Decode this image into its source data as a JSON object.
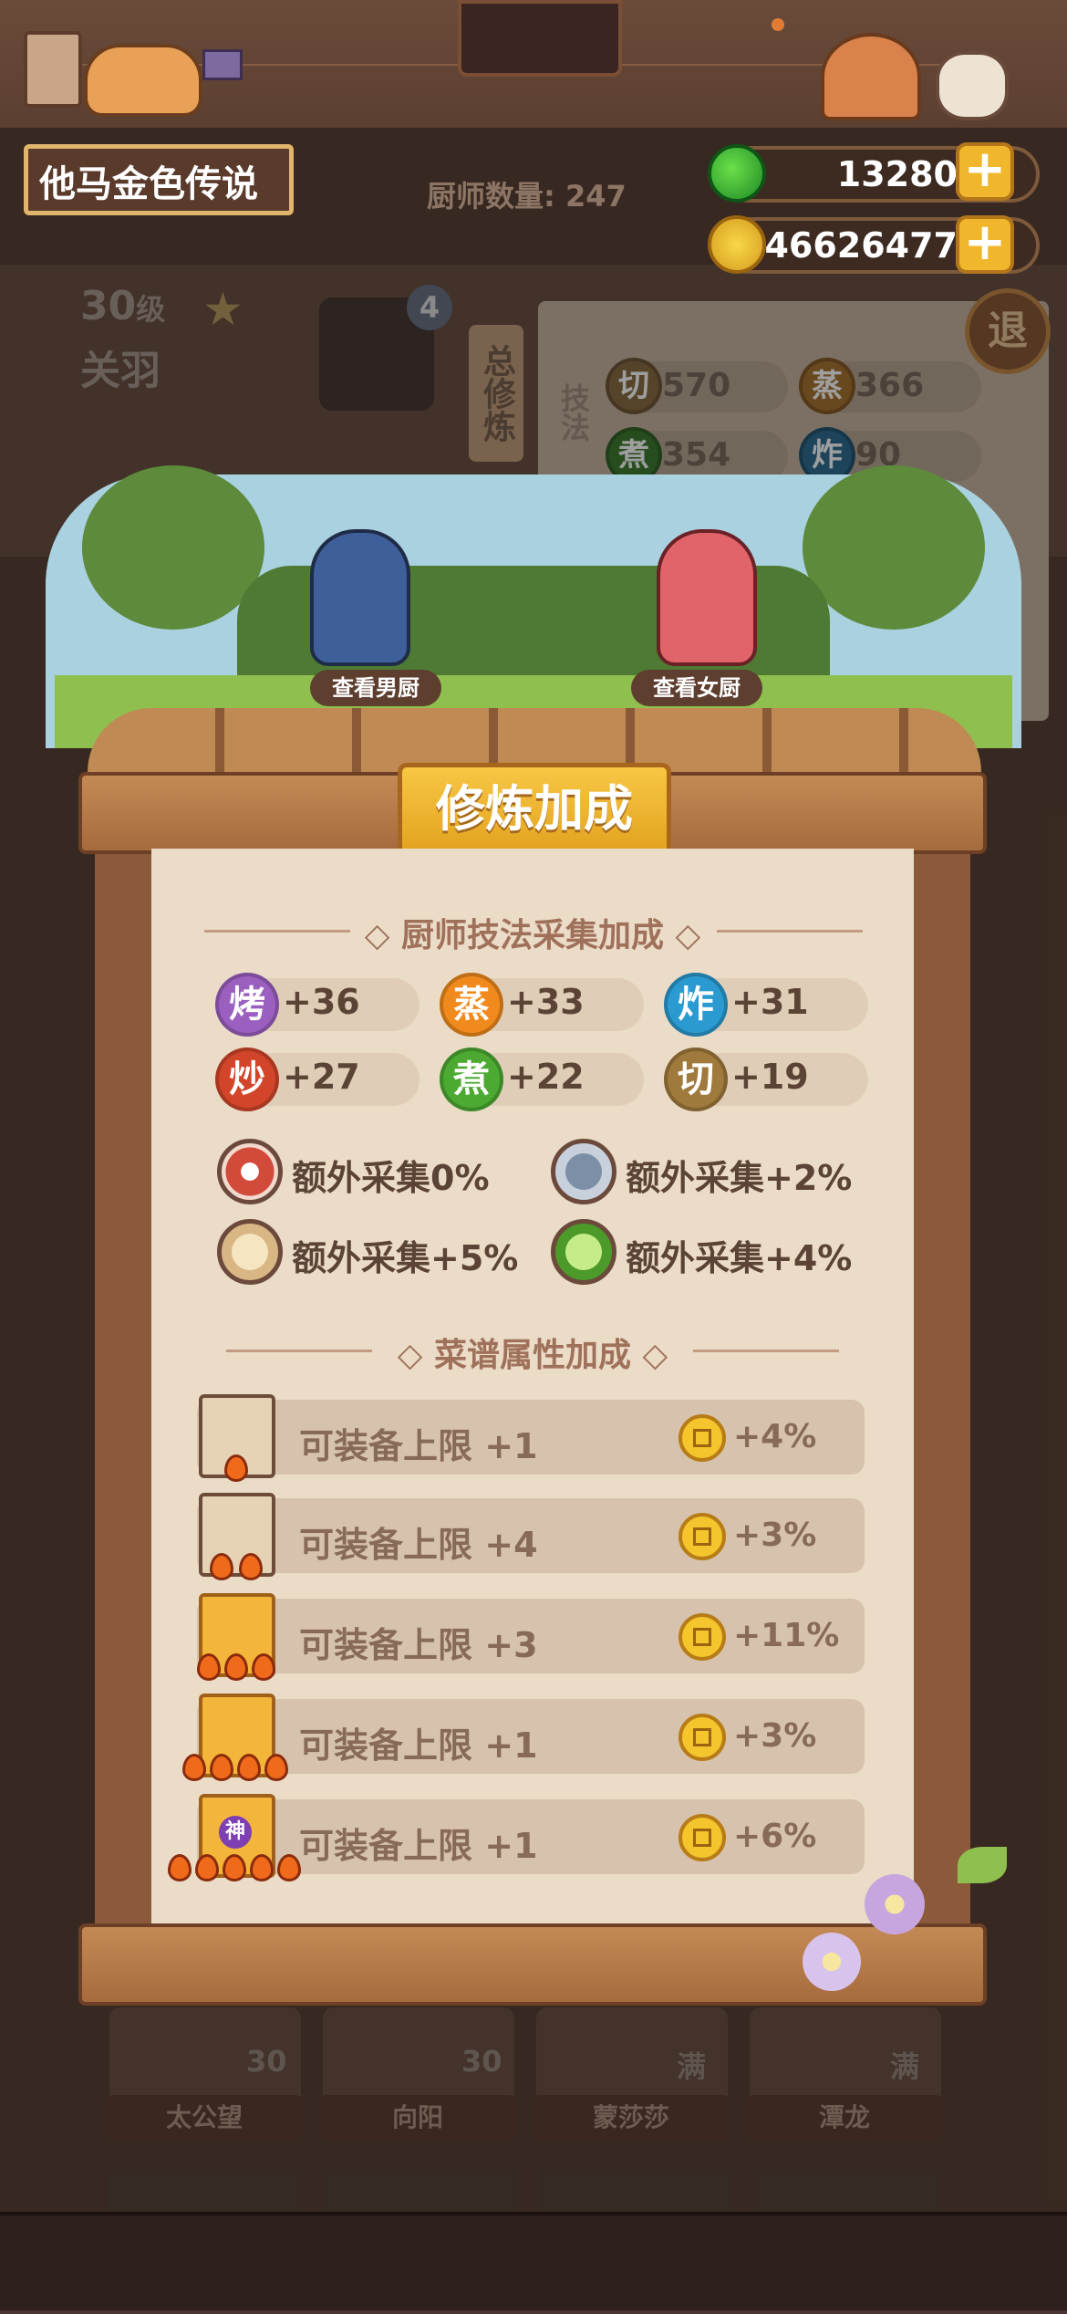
{
  "header": {
    "player_name": "他马金色传说",
    "chef_count_label": "厨师数量:",
    "chef_count": "247",
    "jade": "13280",
    "coins": "46626477"
  },
  "background": {
    "chef_level": "30",
    "chef_level_unit": "级",
    "chef_name": "关羽",
    "badge_count": "4",
    "total_train_label": "总修炼",
    "skill_label": "技法",
    "skills_bg": [
      {
        "icon": "切",
        "value": "570"
      },
      {
        "icon": "蒸",
        "value": "366"
      },
      {
        "icon": "煮",
        "value": "354"
      },
      {
        "icon": "炸",
        "value": "90"
      }
    ],
    "exit_label": "退",
    "bottom_cards": [
      {
        "name": "太公望",
        "level": "30"
      },
      {
        "name": "向阳",
        "level": "30"
      },
      {
        "name": "蒙莎莎",
        "level": "满"
      },
      {
        "name": "潭龙",
        "level": "满"
      }
    ]
  },
  "scene": {
    "male_button": "查看男厨",
    "female_button": "查看女厨"
  },
  "panel": {
    "title": "修炼加成",
    "section1": "厨师技法采集加成",
    "skills": [
      {
        "icon": "烤",
        "value": "+36",
        "color": "#9b5fc0"
      },
      {
        "icon": "蒸",
        "value": "+33",
        "color": "#f08a1c"
      },
      {
        "icon": "炸",
        "value": "+31",
        "color": "#2a9ad0"
      },
      {
        "icon": "炒",
        "value": "+27",
        "color": "#d2452a"
      },
      {
        "icon": "煮",
        "value": "+22",
        "color": "#4caa32"
      },
      {
        "icon": "切",
        "value": "+19",
        "color": "#a07a3c"
      }
    ],
    "extras": [
      {
        "icon": "meat-icon",
        "text": "额外采集0%"
      },
      {
        "icon": "fish-icon",
        "text": "额外采集+2%"
      },
      {
        "icon": "flour-icon",
        "text": "额外采集+5%"
      },
      {
        "icon": "cabbage-icon",
        "text": "额外采集+4%"
      }
    ],
    "section2": "菜谱属性加成",
    "recipes": [
      {
        "stars": 1,
        "text": "可装备上限 +1",
        "pct": "+4%"
      },
      {
        "stars": 2,
        "text": "可装备上限 +4",
        "pct": "+3%"
      },
      {
        "stars": 3,
        "text": "可装备上限 +3",
        "pct": "+11%"
      },
      {
        "stars": 4,
        "text": "可装备上限 +1",
        "pct": "+3%"
      },
      {
        "stars": 5,
        "text": "可装备上限 +1",
        "pct": "+6%",
        "badge": "神"
      }
    ]
  }
}
